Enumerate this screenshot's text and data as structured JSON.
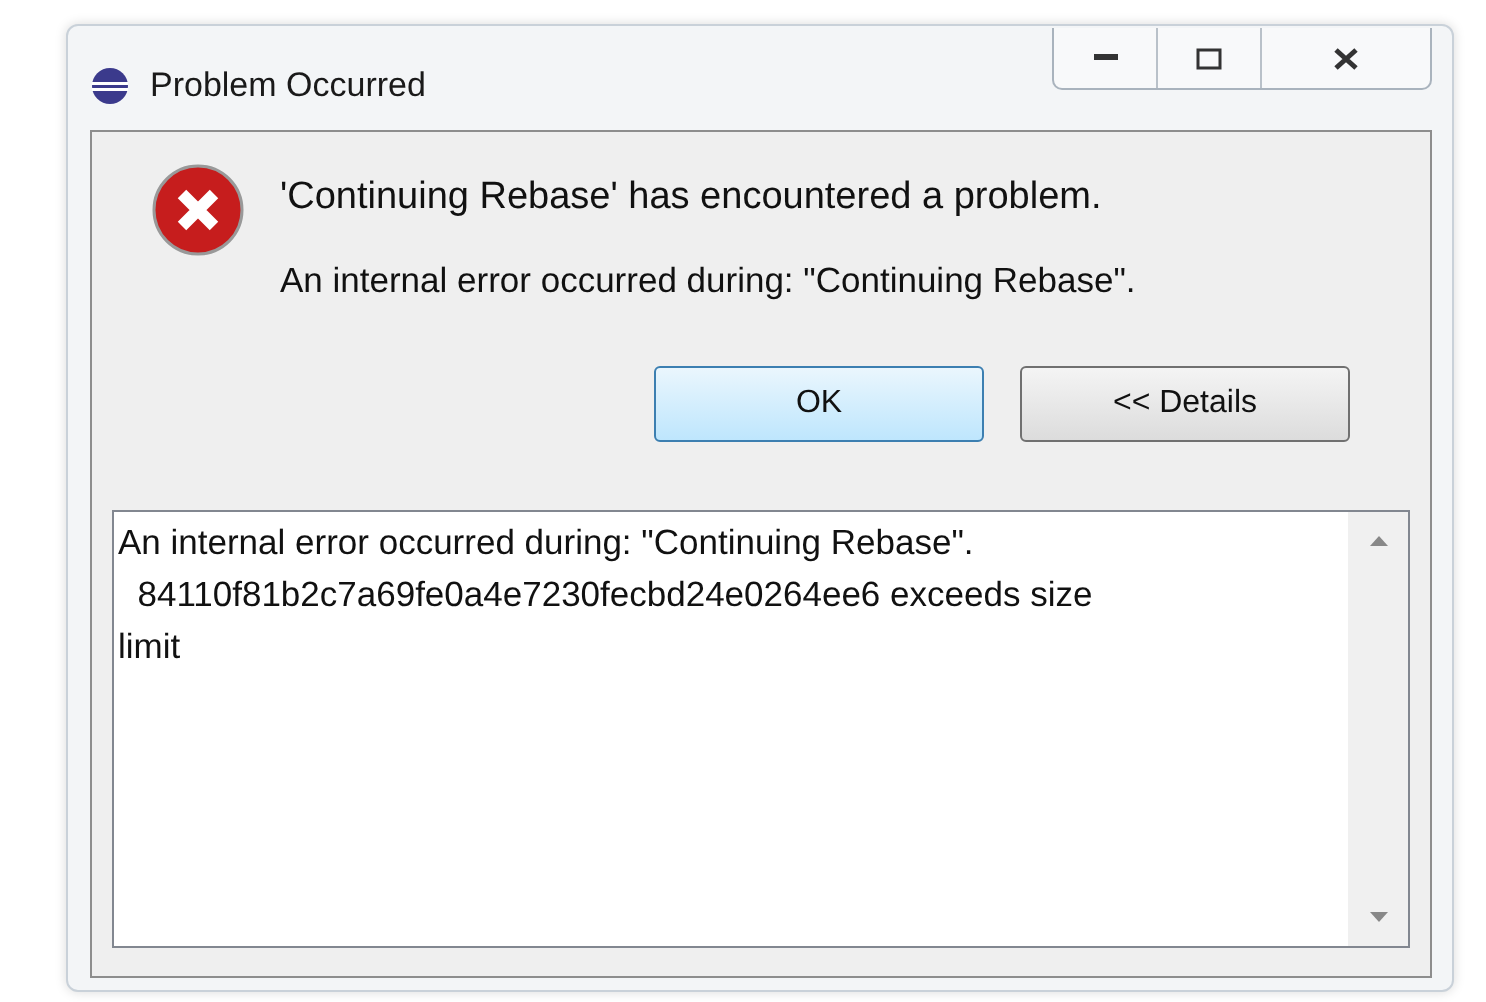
{
  "window": {
    "title": "Problem Occurred",
    "controls": [
      {
        "kind": "minimize"
      },
      {
        "kind": "maximize"
      },
      {
        "kind": "close"
      }
    ]
  },
  "message": {
    "title": "'Continuing Rebase' has encountered a problem.",
    "detail": "An internal error occurred during: \"Continuing Rebase\"."
  },
  "buttons": [
    {
      "label": "OK",
      "default": true
    },
    {
      "label": "<< Details",
      "default": false
    }
  ],
  "details": {
    "text": "An internal error occurred during: \"Continuing Rebase\".\n  84110f81b2c7a69fe0a4e7230fecbd24e0264ee6 exceeds size limit"
  }
}
